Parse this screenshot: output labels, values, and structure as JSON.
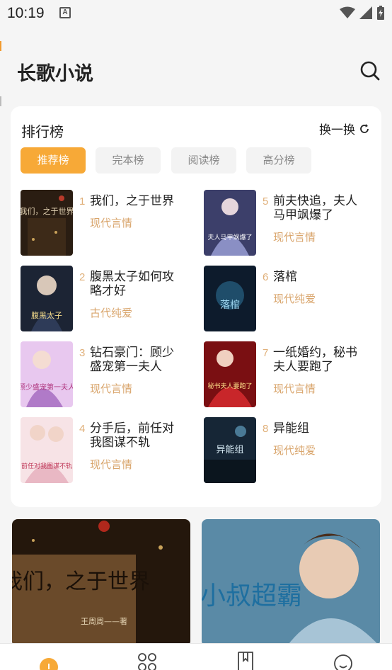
{
  "status": {
    "time": "10:19",
    "notif_letter": "A"
  },
  "header": {
    "title": "长歌小说",
    "search_icon": "search-icon"
  },
  "ranking": {
    "title": "排行榜",
    "refresh_label": "换一换",
    "tabs": [
      {
        "label": "推荐榜",
        "active": true
      },
      {
        "label": "完本榜",
        "active": false
      },
      {
        "label": "阅读榜",
        "active": false
      },
      {
        "label": "高分榜",
        "active": false
      }
    ],
    "books": [
      {
        "rank": "1",
        "name": "我们，之于世界",
        "category": "现代言情",
        "cover_text": "我们，之于世界"
      },
      {
        "rank": "2",
        "name": "腹黑太子如何攻略才好",
        "category": "古代纯爱",
        "cover_text": "腹黑太子"
      },
      {
        "rank": "3",
        "name": "钻石豪门：顾少盛宠第一夫人",
        "category": "现代言情",
        "cover_text": "顾少盛宠第一夫人"
      },
      {
        "rank": "4",
        "name": "分手后，前任对我图谋不轨",
        "category": "现代言情",
        "cover_text": "前任对我图谋不轨"
      },
      {
        "rank": "5",
        "name": "前夫快追，夫人马甲飒爆了",
        "category": "现代言情",
        "cover_text": "夫人马甲飒爆了"
      },
      {
        "rank": "6",
        "name": "落棺",
        "category": "现代纯爱",
        "cover_text": "落棺"
      },
      {
        "rank": "7",
        "name": "一纸婚约，秘书夫人要跑了",
        "category": "现代言情",
        "cover_text": "秘书夫人要跑了"
      },
      {
        "rank": "8",
        "name": "异能组",
        "category": "现代纯爱",
        "cover_text": "异能组"
      }
    ]
  },
  "banners": [
    {
      "title": "我们，之于世界",
      "author": "王周周——著"
    },
    {
      "title": "小叔超霸"
    }
  ],
  "colors": {
    "accent": "#f7a937",
    "category": "#d9a56c",
    "rank": "#e0b07a"
  }
}
